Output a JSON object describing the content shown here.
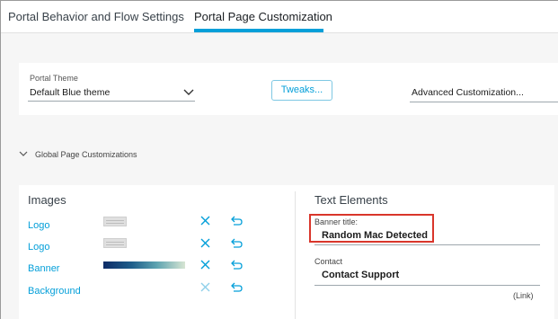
{
  "tabs": [
    {
      "label": "Portal Behavior and Flow Settings",
      "active": false
    },
    {
      "label": "Portal Page Customization",
      "active": true
    }
  ],
  "theme": {
    "label": "Portal Theme",
    "value": "Default Blue theme"
  },
  "tweaks_button": "Tweaks...",
  "advanced_customization": "Advanced Customization...",
  "global_section": "Global Page Customizations",
  "images": {
    "title": "Images",
    "items": [
      {
        "label": "Logo",
        "thumb": "logo-image"
      },
      {
        "label": "Logo",
        "thumb": "logo-image"
      },
      {
        "label": "Banner",
        "thumb": "banner-gradient"
      },
      {
        "label": "Background",
        "thumb": "none"
      }
    ]
  },
  "text_elements": {
    "title": "Text Elements",
    "banner_title_label": "Banner title:",
    "banner_title_value": "Random Mac Detected",
    "contact_label": "Contact",
    "contact_value": "Contact Support",
    "link_label": "(Link)"
  },
  "colors": {
    "accent": "#049fd9",
    "highlight": "#d9362b"
  }
}
